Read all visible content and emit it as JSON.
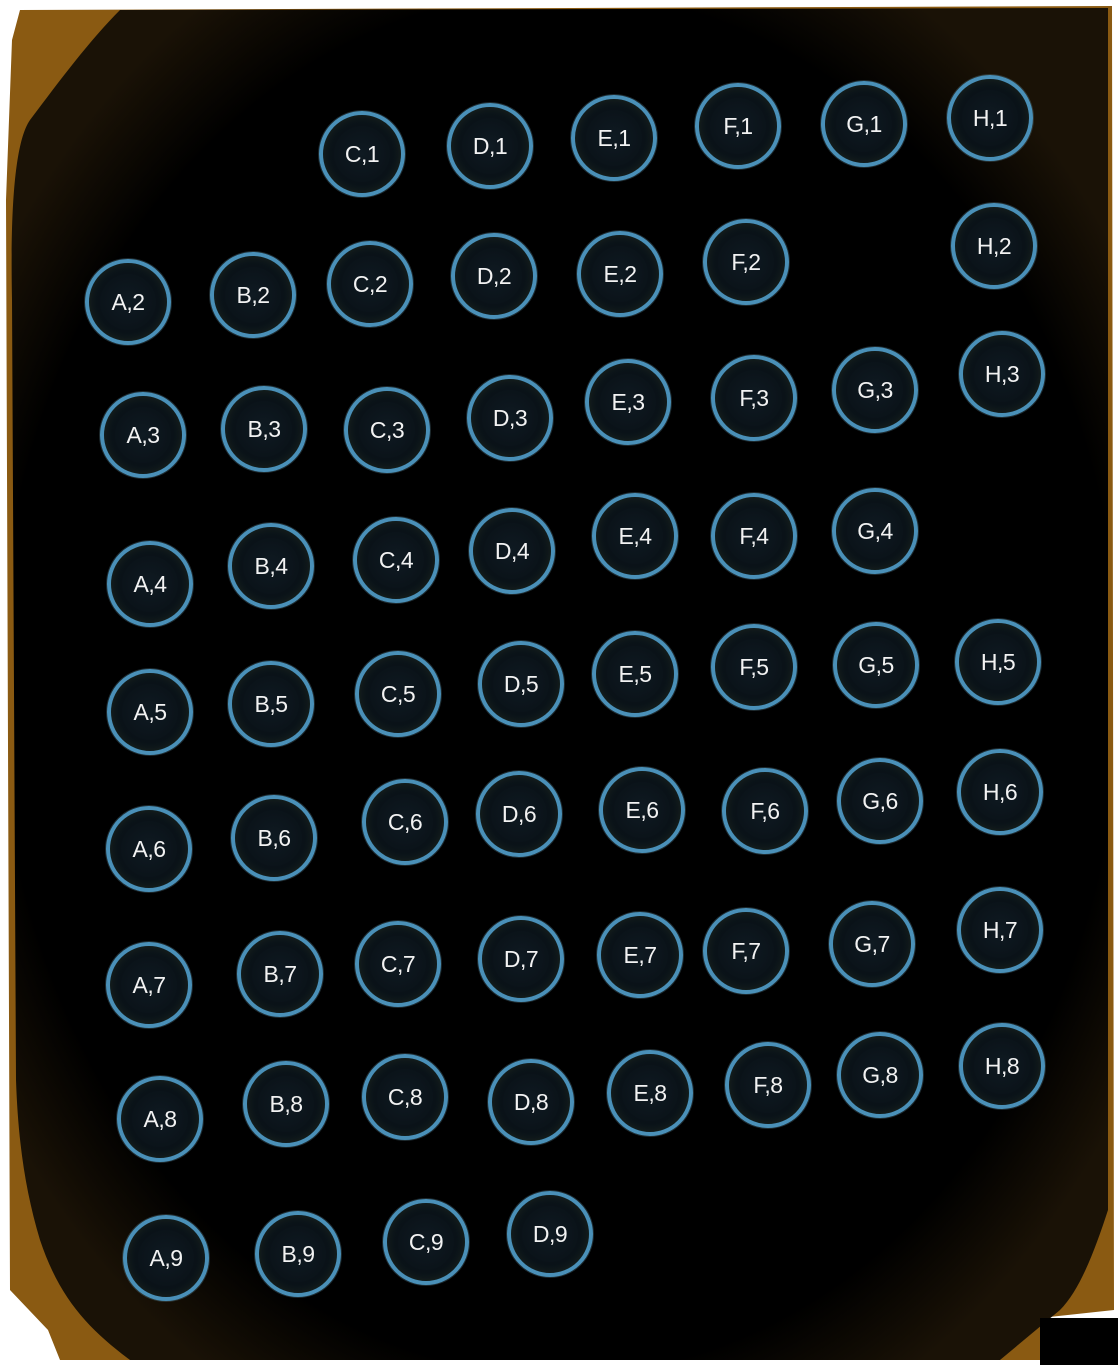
{
  "colors": {
    "page_background": "#ffffff",
    "slide_background": "#000000",
    "slide_edge": "#8a5a12",
    "well_ring": "#4a90b8",
    "label_text": "#f2f2f2"
  },
  "wells": [
    {
      "label": "C,1"
    },
    {
      "label": "D,1"
    },
    {
      "label": "E,1"
    },
    {
      "label": "F,1"
    },
    {
      "label": "G,1"
    },
    {
      "label": "H,1"
    },
    {
      "label": "A,2"
    },
    {
      "label": "B,2"
    },
    {
      "label": "C,2"
    },
    {
      "label": "D,2"
    },
    {
      "label": "E,2"
    },
    {
      "label": "F,2"
    },
    {
      "label": "H,2"
    },
    {
      "label": "A,3"
    },
    {
      "label": "B,3"
    },
    {
      "label": "C,3"
    },
    {
      "label": "D,3"
    },
    {
      "label": "E,3"
    },
    {
      "label": "F,3"
    },
    {
      "label": "G,3"
    },
    {
      "label": "H,3"
    },
    {
      "label": "A,4"
    },
    {
      "label": "B,4"
    },
    {
      "label": "C,4"
    },
    {
      "label": "D,4"
    },
    {
      "label": "E,4"
    },
    {
      "label": "F,4"
    },
    {
      "label": "G,4"
    },
    {
      "label": "A,5"
    },
    {
      "label": "B,5"
    },
    {
      "label": "C,5"
    },
    {
      "label": "D,5"
    },
    {
      "label": "E,5"
    },
    {
      "label": "F,5"
    },
    {
      "label": "G,5"
    },
    {
      "label": "H,5"
    },
    {
      "label": "A,6"
    },
    {
      "label": "B,6"
    },
    {
      "label": "C,6"
    },
    {
      "label": "D,6"
    },
    {
      "label": "E,6"
    },
    {
      "label": "F,6"
    },
    {
      "label": "G,6"
    },
    {
      "label": "H,6"
    },
    {
      "label": "A,7"
    },
    {
      "label": "B,7"
    },
    {
      "label": "C,7"
    },
    {
      "label": "D,7"
    },
    {
      "label": "E,7"
    },
    {
      "label": "F,7"
    },
    {
      "label": "G,7"
    },
    {
      "label": "H,7"
    },
    {
      "label": "A,8"
    },
    {
      "label": "B,8"
    },
    {
      "label": "C,8"
    },
    {
      "label": "D,8"
    },
    {
      "label": "E,8"
    },
    {
      "label": "F,8"
    },
    {
      "label": "G,8"
    },
    {
      "label": "H,8"
    },
    {
      "label": "A,9"
    },
    {
      "label": "B,9"
    },
    {
      "label": "C,9"
    },
    {
      "label": "D,9"
    }
  ]
}
